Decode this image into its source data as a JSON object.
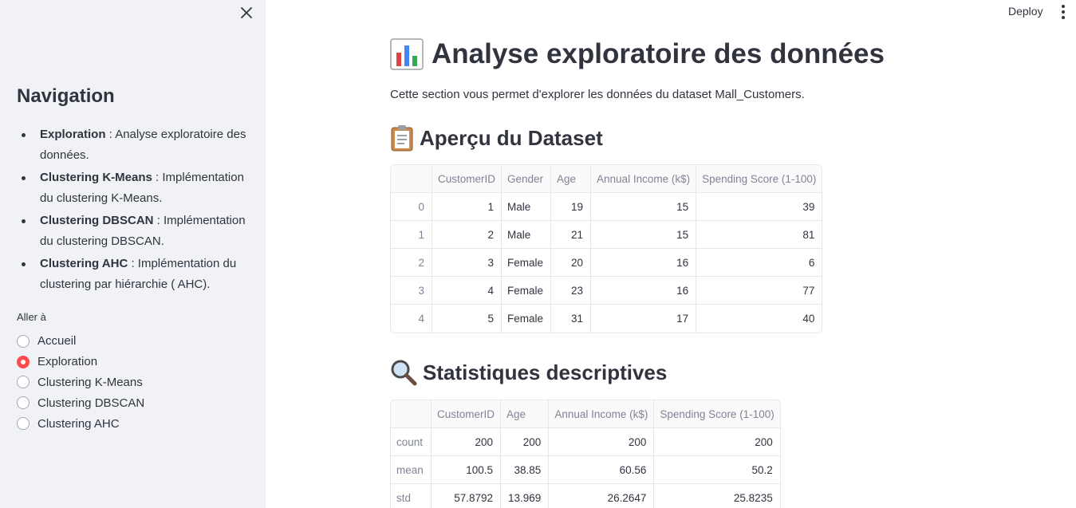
{
  "sidebar": {
    "nav_title": "Navigation",
    "nav_items": [
      {
        "bold": "Exploration",
        "rest": " : Analyse exploratoire des données."
      },
      {
        "bold": "Clustering K-Means",
        "rest": " : Implémentation du clustering K-Means."
      },
      {
        "bold": "Clustering DBSCAN",
        "rest": " : Implémentation du clustering DBSCAN."
      },
      {
        "bold": "Clustering AHC",
        "rest": " : Implémentation du clustering par hiérarchie ( AHC)."
      }
    ],
    "goto_label": "Aller à",
    "radio_options": [
      "Accueil",
      "Exploration",
      "Clustering K-Means",
      "Clustering DBSCAN",
      "Clustering AHC"
    ],
    "selected": "Exploration"
  },
  "header": {
    "deploy_label": "Deploy"
  },
  "main": {
    "title_emoji": "📊",
    "title": "Analyse exploratoire des données",
    "intro": "Cette section vous permet d'explorer les données du dataset Mall_Customers.",
    "preview_emoji": "📋",
    "preview_title": "Aperçu du Dataset",
    "preview_table": {
      "columns": [
        "",
        "CustomerID",
        "Gender",
        "Age",
        "Annual Income (k$)",
        "Spending Score (1-100)"
      ],
      "rows": [
        [
          "0",
          "1",
          "Male",
          "19",
          "15",
          "39"
        ],
        [
          "1",
          "2",
          "Male",
          "21",
          "15",
          "81"
        ],
        [
          "2",
          "3",
          "Female",
          "20",
          "16",
          "6"
        ],
        [
          "3",
          "4",
          "Female",
          "23",
          "16",
          "77"
        ],
        [
          "4",
          "5",
          "Female",
          "31",
          "17",
          "40"
        ]
      ]
    },
    "stats_emoji": "🔍",
    "stats_title": "Statistiques descriptives",
    "stats_table": {
      "columns": [
        "",
        "CustomerID",
        "Age",
        "Annual Income (k$)",
        "Spending Score (1-100)"
      ],
      "rows": [
        [
          "count",
          "200",
          "200",
          "200",
          "200"
        ],
        [
          "mean",
          "100.5",
          "38.85",
          "60.56",
          "50.2"
        ],
        [
          "std",
          "57.8792",
          "13.969",
          "26.2647",
          "25.8235"
        ]
      ]
    }
  }
}
